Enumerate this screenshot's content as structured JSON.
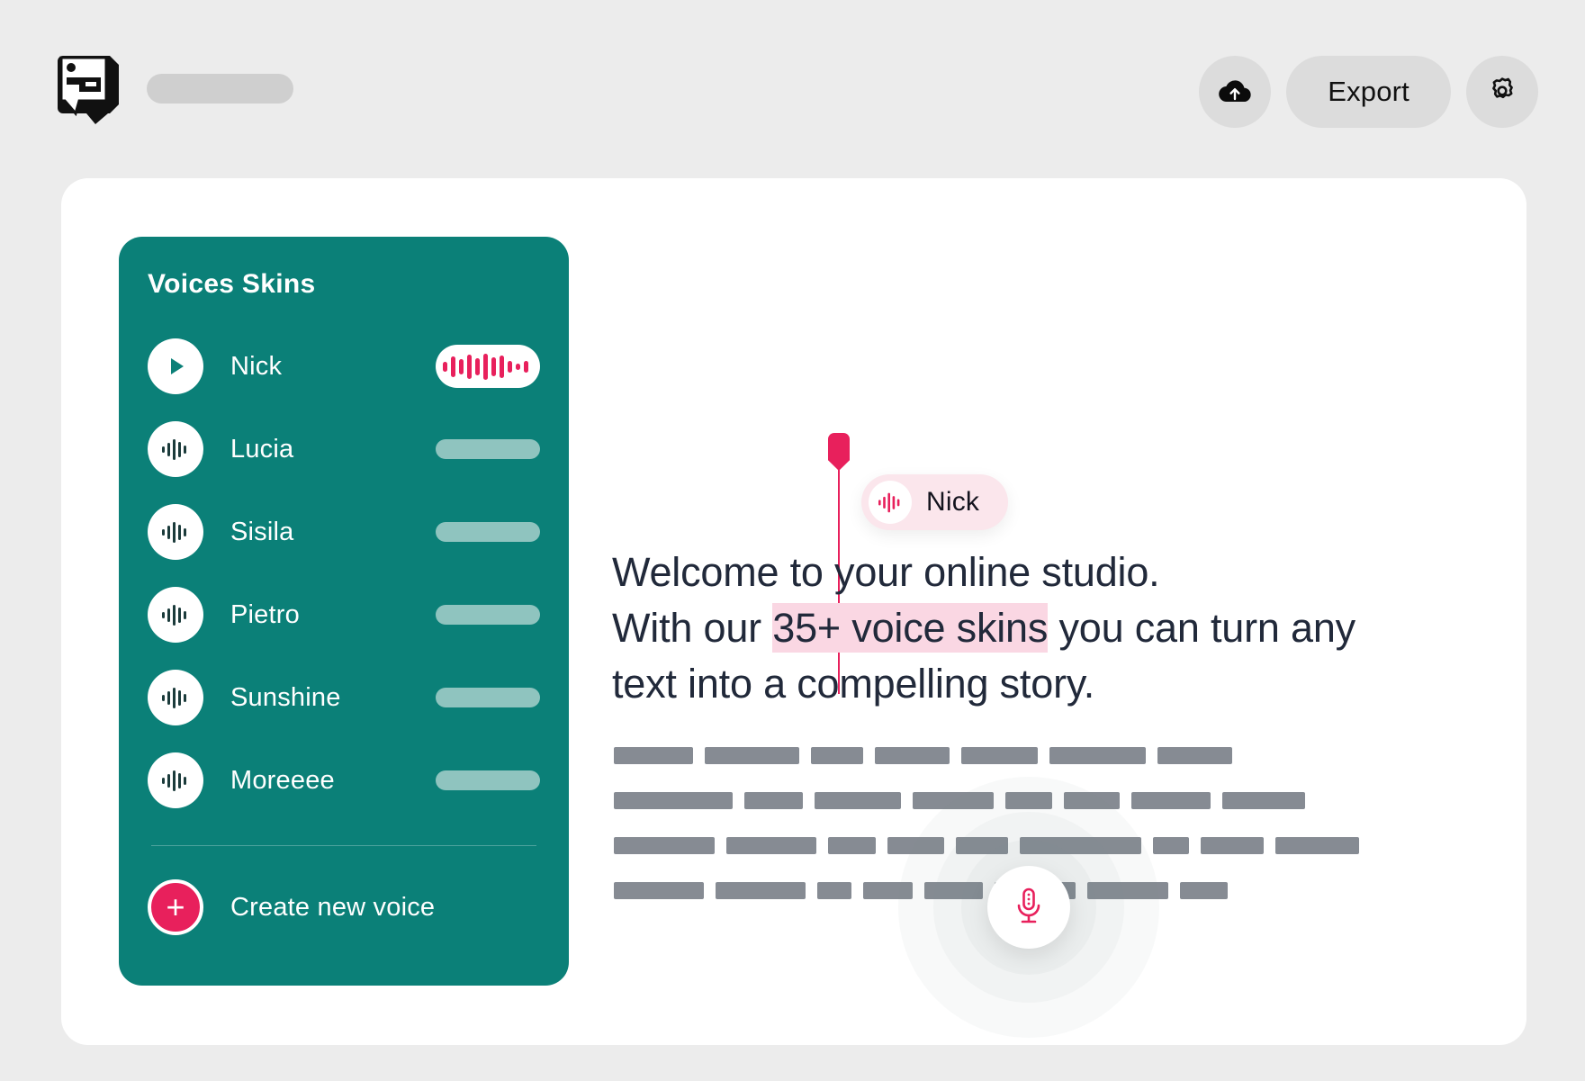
{
  "header": {
    "logo_icon": "speech-bubble-logo",
    "title_placeholder": "",
    "upload_icon": "cloud-upload-icon",
    "export_label": "Export",
    "settings_icon": "gear-icon"
  },
  "sidebar": {
    "title": "Voices Skins",
    "voices": [
      {
        "name": "Nick",
        "icon": "play-icon",
        "active": true
      },
      {
        "name": "Lucia",
        "icon": "waveform-icon",
        "active": false
      },
      {
        "name": "Sisila",
        "icon": "waveform-icon",
        "active": false
      },
      {
        "name": "Pietro",
        "icon": "waveform-icon",
        "active": false
      },
      {
        "name": "Sunshine",
        "icon": "waveform-icon",
        "active": false
      },
      {
        "name": "Moreeee",
        "icon": "waveform-icon",
        "active": false
      }
    ],
    "create_label": "Create new voice",
    "create_icon": "plus-icon"
  },
  "editor": {
    "speaker_chip": {
      "name": "Nick",
      "icon": "waveform-icon"
    },
    "headline": {
      "line1": "Welcome to your online studio.",
      "line2_before": "With our ",
      "line2_highlight": "35+ voice skins",
      "line2_after": " you can turn any",
      "line3": "text into a compelling story."
    },
    "skeleton_rows": [
      [
        88,
        105,
        58,
        83,
        85,
        107,
        83
      ],
      [
        132,
        65,
        96,
        90,
        52,
        62,
        88,
        92
      ],
      [
        112,
        100,
        53,
        63,
        58,
        135,
        40,
        70,
        93
      ],
      [
        100,
        100,
        38,
        55,
        65,
        90,
        90,
        53
      ]
    ],
    "mic_icon": "microphone-icon"
  },
  "colors": {
    "page_bg": "#ececec",
    "card_bg": "#ffffff",
    "sidebar_teal": "#0b8078",
    "accent_pink": "#e8205c",
    "highlight_pink": "#fad7e3",
    "text_dark": "#21293a",
    "meter_muted": "#8fc4bf",
    "skeleton_gray": "#868b93"
  }
}
